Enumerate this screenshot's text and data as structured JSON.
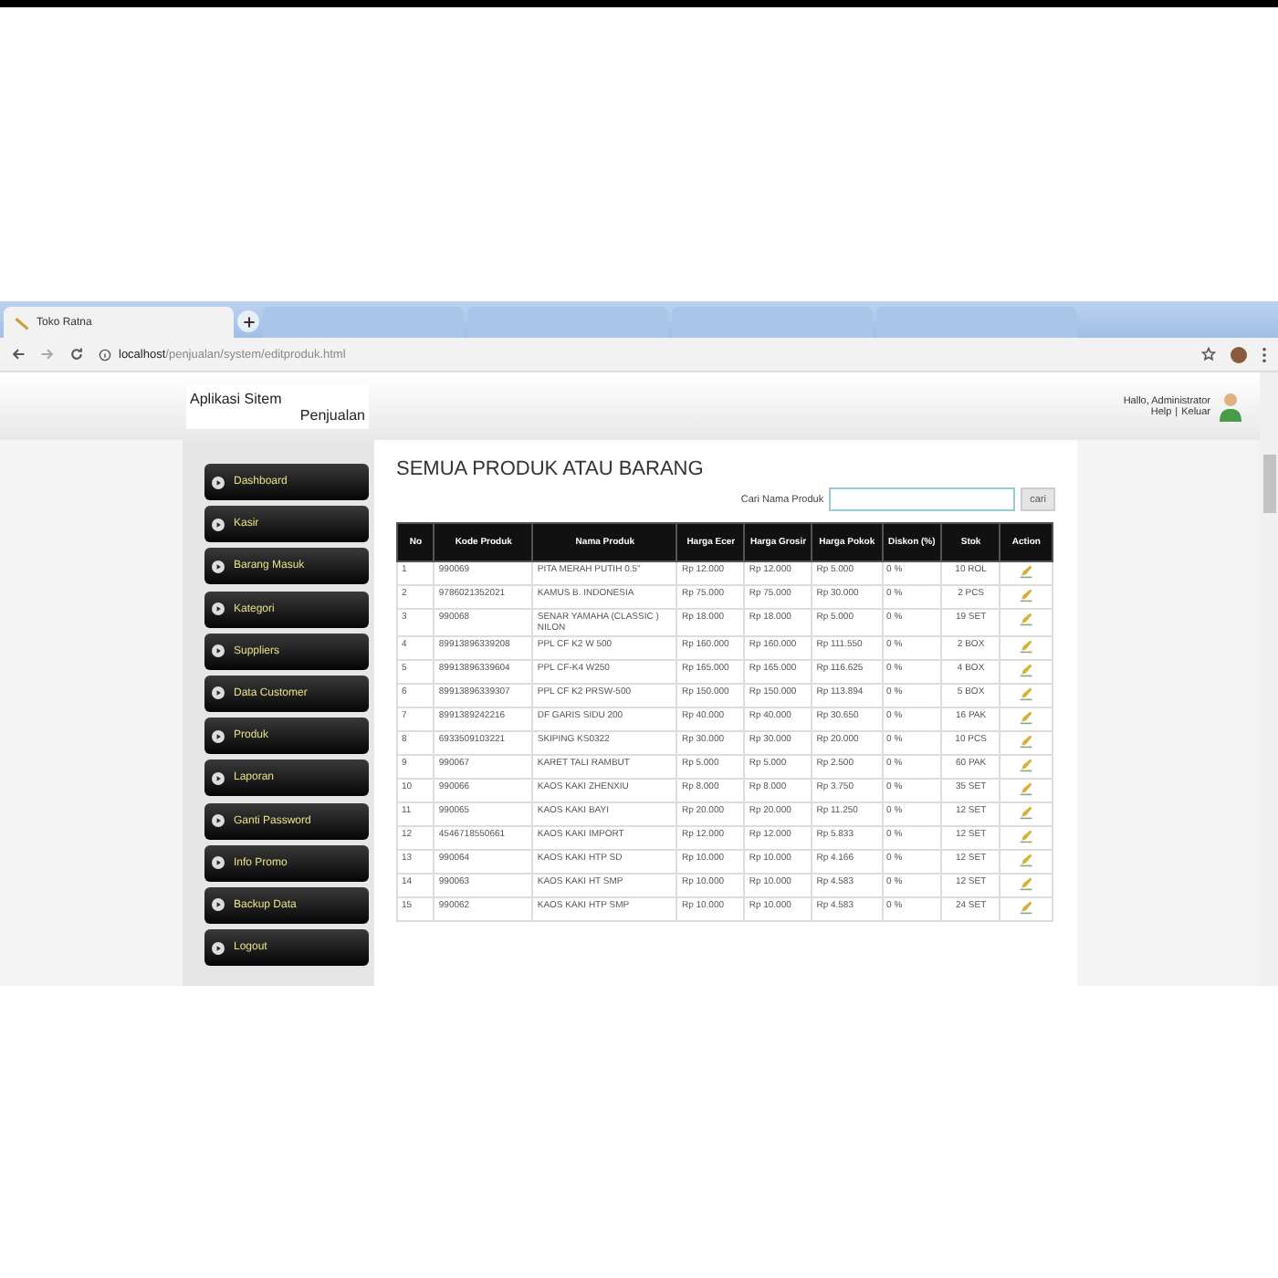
{
  "browser": {
    "tabs": [
      {
        "title": "Toko Ratna",
        "selected": true
      },
      {
        "selected": false
      },
      {
        "selected": false
      },
      {
        "selected": false
      },
      {
        "selected": false
      }
    ],
    "url_host": "localhost",
    "url_path": "/penjualan/system/editproduk.html"
  },
  "header": {
    "app_title_1": "Aplikasi Sitem",
    "app_title_2": "Penjualan",
    "greeting": "Hallo, Administrator",
    "help": "Help",
    "separator": "|",
    "logout": "Keluar"
  },
  "sidebar": {
    "items": [
      "Dashboard",
      "Kasir",
      "Barang Masuk",
      "Kategori",
      "Suppliers",
      "Data Customer",
      "Produk",
      "Laporan",
      "Ganti Password",
      "Info Promo",
      "Backup Data",
      "Logout"
    ]
  },
  "page_title": "SEMUA PRODUK ATAU BARANG",
  "search": {
    "label": "Cari Nama Produk",
    "button": "cari"
  },
  "table": {
    "columns": [
      "No",
      "Kode Produk",
      "Nama Produk",
      "Harga Ecer",
      "Harga Grosir",
      "Harga Pokok",
      "Diskon (%)",
      "Stok",
      "Action"
    ],
    "rows": [
      [
        "1",
        "990069",
        "PITA MERAH PUTIH 0.5\"",
        "Rp 12.000",
        "Rp 12.000",
        "Rp 5.000",
        "0 %",
        "10 ROL"
      ],
      [
        "2",
        "9786021352021",
        "KAMUS B. INDONESIA",
        "Rp 75.000",
        "Rp 75.000",
        "Rp 30.000",
        "0 %",
        "2 PCS"
      ],
      [
        "3",
        "990068",
        "SENAR YAMAHA (CLASSIC ) NILON",
        "Rp 18.000",
        "Rp 18.000",
        "Rp 5.000",
        "0 %",
        "19 SET"
      ],
      [
        "4",
        "89913896339208",
        "PPL CF K2 W 500",
        "Rp 160.000",
        "Rp 160.000",
        "Rp 111.550",
        "0 %",
        "2 BOX"
      ],
      [
        "5",
        "89913896339604",
        "PPL CF-K4 W250",
        "Rp 165.000",
        "Rp 165.000",
        "Rp 116.625",
        "0 %",
        "4 BOX"
      ],
      [
        "6",
        "89913896339307",
        "PPL CF K2 PRSW-500",
        "Rp 150.000",
        "Rp 150.000",
        "Rp 113.894",
        "0 %",
        "5 BOX"
      ],
      [
        "7",
        "8991389242216",
        "DF GARIS SIDU 200",
        "Rp 40.000",
        "Rp 40.000",
        "Rp 30.650",
        "0 %",
        "16 PAK"
      ],
      [
        "8",
        "6933509103221",
        "SKIPING KS0322",
        "Rp 30.000",
        "Rp 30.000",
        "Rp 20.000",
        "0 %",
        "10 PCS"
      ],
      [
        "9",
        "990067",
        "KARET TALI RAMBUT",
        "Rp 5.000",
        "Rp 5.000",
        "Rp 2.500",
        "0 %",
        "60 PAK"
      ],
      [
        "10",
        "990066",
        "KAOS KAKI ZHENXIU",
        "Rp 8.000",
        "Rp 8.000",
        "Rp 3.750",
        "0 %",
        "35 SET"
      ],
      [
        "11",
        "990065",
        "KAOS KAKI BAYI",
        "Rp 20.000",
        "Rp 20.000",
        "Rp 11.250",
        "0 %",
        "12 SET"
      ],
      [
        "12",
        "4546718550661",
        "KAOS KAKI IMPORT",
        "Rp 12.000",
        "Rp 12.000",
        "Rp 5.833",
        "0 %",
        "12 SET"
      ],
      [
        "13",
        "990064",
        "KAOS KAKI HTP SD",
        "Rp 10.000",
        "Rp 10.000",
        "Rp 4.166",
        "0 %",
        "12 SET"
      ],
      [
        "14",
        "990063",
        "KAOS KAKI HT SMP",
        "Rp 10.000",
        "Rp 10.000",
        "Rp 4.583",
        "0 %",
        "12 SET"
      ],
      [
        "15",
        "990062",
        "KAOS KAKI HTP SMP",
        "Rp 10.000",
        "Rp 10.000",
        "Rp 4.583",
        "0 %",
        "24 SET"
      ]
    ]
  }
}
